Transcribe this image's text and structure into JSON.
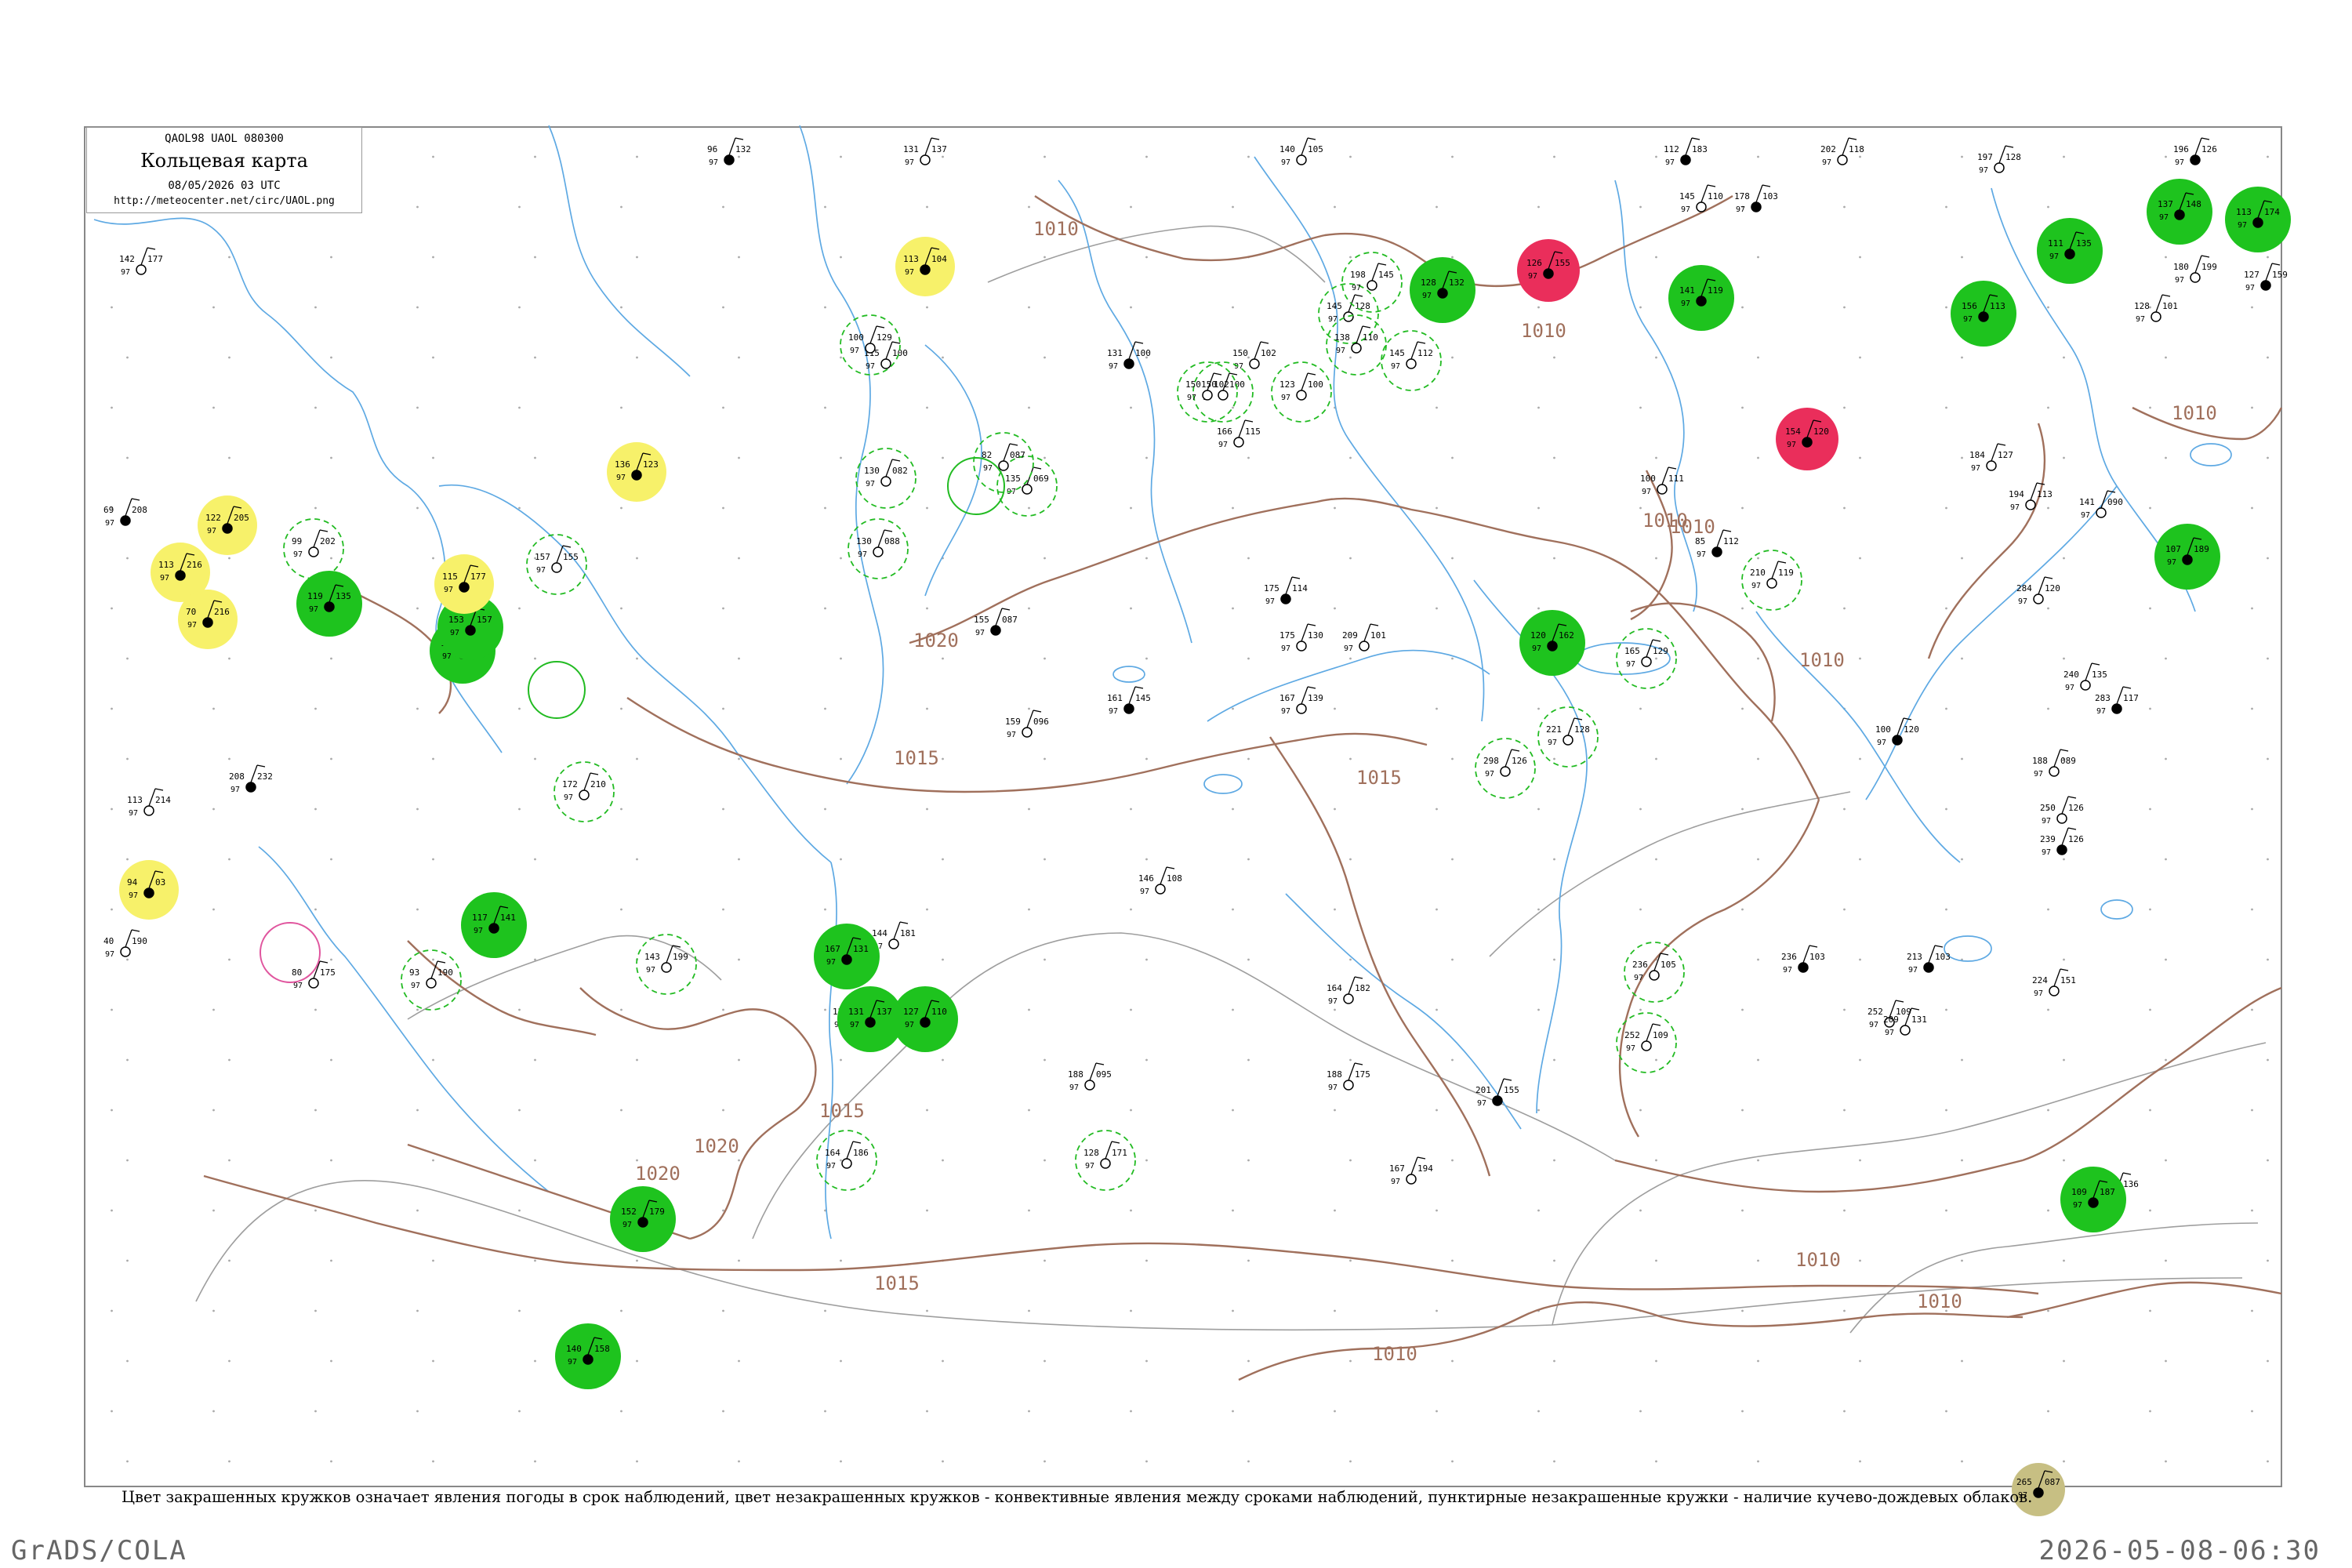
{
  "header": {
    "code": "QAOL98  UAOL  080300",
    "title": "Кольцевая карта",
    "date": "08/05/2026 03 UTC",
    "url": "http://meteocenter.net/circ/UAOL.png"
  },
  "caption": "Цвет закрашенных кружков означает явления погоды в срок наблюдений, цвет незакрашенных кружков - конвективные явления между сроками наблюдений, пунктирные незакрашенные кружки - наличие кучево-дождевых облаков.",
  "footer": {
    "left": "GrADS/COLA",
    "right": "2026-05-08-06:30"
  },
  "colors": {
    "river": "#5ea9e3",
    "isobar": "#a0705c",
    "border": "#9e9e9e",
    "rain": "#1ec31e",
    "drizzle": "#f7f16a",
    "thunder": "#ea2e5b",
    "dust": "#c7bf83"
  },
  "isobars": {
    "labels": [
      "1010",
      "1010",
      "1010",
      "1010",
      "1015",
      "1015",
      "1020",
      "1020",
      "1020",
      "1015",
      "1010",
      "1010",
      "1010",
      "1015",
      "1010",
      "1010"
    ]
  },
  "stations": [
    {
      "fill": "rain",
      "t": "119",
      "p": "135"
    },
    {
      "fill": "rain",
      "t": "129",
      "p": "124"
    },
    {
      "fill": "rain",
      "t": "153",
      "p": "157"
    },
    {
      "fill": "rain",
      "t": "127",
      "p": "110"
    },
    {
      "fill": "rain",
      "t": "167",
      "p": "131"
    },
    {
      "fill": "rain",
      "t": "131",
      "p": "137"
    },
    {
      "fill": "rain",
      "t": "156",
      "p": "113"
    },
    {
      "fill": "rain",
      "t": "109",
      "p": "187"
    },
    {
      "fill": "rain",
      "t": "107",
      "p": "189"
    },
    {
      "fill": "rain",
      "t": "120",
      "p": "162"
    },
    {
      "fill": "rain",
      "t": "141",
      "p": "119"
    },
    {
      "fill": "rain",
      "t": "128",
      "p": "132"
    },
    {
      "fill": "rain",
      "t": "111",
      "p": "135"
    },
    {
      "fill": "rain",
      "t": "137",
      "p": "148"
    },
    {
      "fill": "rain",
      "t": "113",
      "p": "174"
    },
    {
      "fill": "rain",
      "t": "117",
      "p": "141"
    },
    {
      "fill": "rain",
      "t": "152",
      "p": "179"
    },
    {
      "fill": "rain",
      "t": "140",
      "p": "158"
    },
    {
      "fill": "drizzle",
      "t": "122",
      "p": "205"
    },
    {
      "fill": "drizzle",
      "t": "113",
      "p": "216"
    },
    {
      "fill": "drizzle",
      "t": "70",
      "p": "216"
    },
    {
      "fill": "drizzle",
      "t": "113",
      "p": "104"
    },
    {
      "fill": "drizzle",
      "t": "115",
      "p": "177"
    },
    {
      "fill": "drizzle",
      "t": "136",
      "p": "123"
    },
    {
      "fill": "drizzle",
      "t": "94",
      "p": "03"
    },
    {
      "fill": "thunder",
      "t": "126",
      "p": "155"
    },
    {
      "fill": "thunder",
      "t": "154",
      "p": "120"
    },
    {
      "fill": "dust",
      "t": "265",
      "p": "087"
    }
  ],
  "plain_stations": [
    {
      "t": "150",
      "p": "135"
    },
    {
      "t": "142",
      "p": "177"
    },
    {
      "t": "166",
      "p": "124"
    },
    {
      "t": "96",
      "p": "132"
    },
    {
      "t": "131",
      "p": "137"
    },
    {
      "t": "140",
      "p": "105"
    },
    {
      "t": "112",
      "p": "183"
    },
    {
      "t": "202",
      "p": "118"
    },
    {
      "t": "197",
      "p": "128"
    },
    {
      "t": "196",
      "p": "126"
    },
    {
      "t": "175",
      "p": "130"
    },
    {
      "t": "167",
      "p": "139"
    },
    {
      "t": "161",
      "p": "145"
    },
    {
      "t": "159",
      "p": "096"
    },
    {
      "t": "144",
      "p": "181"
    },
    {
      "t": "124",
      "p": "181"
    },
    {
      "t": "186",
      "p": "181"
    },
    {
      "t": "188",
      "p": "095"
    },
    {
      "t": "236",
      "p": "103"
    },
    {
      "t": "252",
      "p": "109"
    },
    {
      "t": "240",
      "p": "135"
    },
    {
      "t": "283",
      "p": "117"
    },
    {
      "t": "284",
      "p": "120"
    },
    {
      "t": "250",
      "p": "126"
    },
    {
      "t": "239",
      "p": "126"
    },
    {
      "t": "224",
      "p": "151"
    },
    {
      "t": "229",
      "p": "136"
    },
    {
      "t": "213",
      "p": "103"
    },
    {
      "t": "209",
      "p": "131"
    },
    {
      "t": "164",
      "p": "182"
    },
    {
      "t": "201",
      "p": "155"
    },
    {
      "t": "188",
      "p": "175"
    },
    {
      "t": "167",
      "p": "194"
    },
    {
      "t": "155",
      "p": "087"
    },
    {
      "t": "146",
      "p": "108"
    },
    {
      "t": "113",
      "p": "214"
    },
    {
      "t": "69",
      "p": "208"
    },
    {
      "t": "40",
      "p": "190"
    },
    {
      "t": "80",
      "p": "175"
    },
    {
      "t": "208",
      "p": "232"
    },
    {
      "t": "184",
      "p": "127"
    },
    {
      "t": "194",
      "p": "113"
    },
    {
      "t": "178",
      "p": "103"
    },
    {
      "t": "145",
      "p": "110"
    },
    {
      "t": "100",
      "p": "111"
    },
    {
      "t": "85",
      "p": "112"
    },
    {
      "t": "128",
      "p": "101"
    },
    {
      "t": "180",
      "p": "199"
    },
    {
      "t": "127",
      "p": "159"
    },
    {
      "t": "141",
      "p": "090"
    },
    {
      "t": "115",
      "p": "100"
    },
    {
      "t": "131",
      "p": "100"
    },
    {
      "t": "150",
      "p": "102"
    },
    {
      "t": "166",
      "p": "115"
    },
    {
      "t": "175",
      "p": "114"
    },
    {
      "t": "209",
      "p": "101"
    },
    {
      "t": "188",
      "p": "089"
    },
    {
      "t": "100",
      "p": "120"
    }
  ],
  "dashed_rings": [
    {
      "t": "100",
      "p": "129"
    },
    {
      "t": "150",
      "p": "100"
    },
    {
      "t": "135",
      "p": "069"
    },
    {
      "t": "298",
      "p": "126"
    },
    {
      "t": "221",
      "p": "128"
    },
    {
      "t": "165",
      "p": "129"
    },
    {
      "t": "210",
      "p": "119"
    },
    {
      "t": "123",
      "p": "100"
    },
    {
      "t": "130",
      "p": "082"
    },
    {
      "t": "130",
      "p": "088"
    },
    {
      "t": "150",
      "p": "102"
    },
    {
      "t": "145",
      "p": "128"
    },
    {
      "t": "164",
      "p": "186"
    },
    {
      "t": "128",
      "p": "171"
    },
    {
      "t": "143",
      "p": "199"
    },
    {
      "t": "99",
      "p": "202"
    },
    {
      "t": "157",
      "p": "155"
    },
    {
      "t": "172",
      "p": "210"
    },
    {
      "t": "93",
      "p": "190"
    },
    {
      "t": "236",
      "p": "105"
    },
    {
      "t": "252",
      "p": "109"
    },
    {
      "t": "198",
      "p": "145"
    },
    {
      "t": "138",
      "p": "110"
    },
    {
      "t": "145",
      "p": "112"
    },
    {
      "t": "82",
      "p": "087"
    }
  ]
}
